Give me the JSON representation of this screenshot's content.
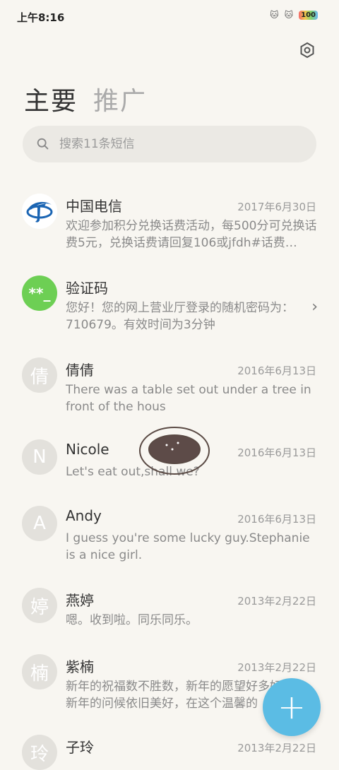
{
  "status": {
    "time": "上午8:16",
    "battery": "100"
  },
  "tabs": {
    "primary": "主要",
    "promo": "推广"
  },
  "search": {
    "placeholder": "搜索11条短信"
  },
  "messages": [
    {
      "name": "中国电信",
      "date": "2017年6月30日",
      "preview": "欢迎参加积分兑换话费活动，每500分可兑换话费5元，兑换话费请回复106或jfdh#话费…",
      "avatar": "telecom-logo"
    },
    {
      "name": "验证码",
      "date": "",
      "preview": "您好！您的网上营业厅登录的随机密码为：710679。有效时间为3分钟",
      "avatar": "**_"
    },
    {
      "name": "倩倩",
      "date": "2016年6月13日",
      "preview": "There was a table set out under a tree in front of the hous",
      "avatar": "倩"
    },
    {
      "name": "Nicole",
      "date": "2016年6月13日",
      "preview": "Let's eat out,shall we?",
      "avatar": "N"
    },
    {
      "name": "Andy",
      "date": "2016年6月13日",
      "preview": "I guess you're some lucky guy.Stephanie is a nice girl.",
      "avatar": "A"
    },
    {
      "name": "燕婷",
      "date": "2013年2月22日",
      "preview": "嗯。收到啦。同乐同乐。",
      "avatar": "婷"
    },
    {
      "name": "紫楠",
      "date": "2013年2月22日",
      "preview": "新年的祝福数不胜数，新年的愿望好多好多，新年的问候依旧美好，在这个温馨的",
      "avatar": "楠"
    },
    {
      "name": "子玲",
      "date": "2013年2月22日",
      "preview": "",
      "avatar": "玲"
    }
  ],
  "colors": {
    "accent": "#5bbce4",
    "green": "#6dcf54",
    "background": "#f8f6f1"
  }
}
